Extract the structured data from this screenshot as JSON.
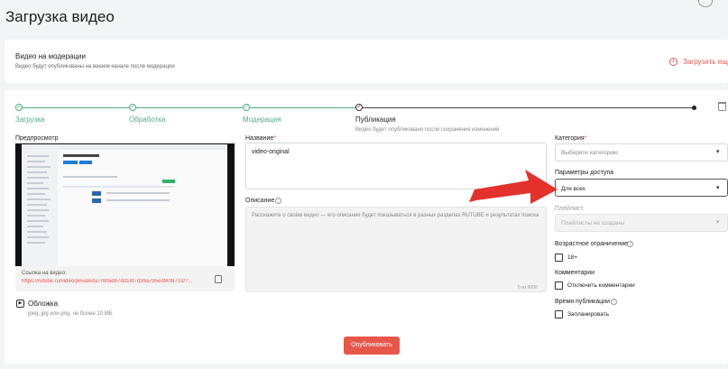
{
  "page": {
    "title": "Загрузка видео"
  },
  "moderation": {
    "title": "Видео на модерации",
    "subtitle": "Видео будут опубликованы на вашем канале после модерации",
    "upload_more": "Загрузить еще"
  },
  "stepper": {
    "steps": [
      {
        "label": "Загрузка",
        "state": "done"
      },
      {
        "label": "Обработка",
        "state": "done"
      },
      {
        "label": "Модерация",
        "state": "done"
      },
      {
        "label": "Публикация",
        "state": "current"
      }
    ],
    "current_note": "Видео будет опубликовано после сохранения изменений",
    "done_mark": "✓"
  },
  "preview": {
    "label": "Предпросмотр",
    "link_label": "Ссылка на видео:",
    "link_url": "https://rutube.ru/video/private/fa708fad87dd18f7d39a795ed90f8713/?..."
  },
  "cover": {
    "label": "Обложка",
    "hint": "jpeg, jpg или png, не более 10 МБ"
  },
  "form": {
    "name_label": "Название",
    "name_value": "video-original",
    "name_counter": "",
    "description_label": "Описание",
    "description_placeholder": "Расскажите о своём видео — его описание будет показываться в разных разделах RUTUBE и результатах поиска",
    "description_counter": "0 из 5000",
    "required_mark": "*",
    "help_mark": "?"
  },
  "settings": {
    "category_label": "Категория",
    "category_placeholder": "Выберите категорию",
    "access_label": "Параметры доступа",
    "access_value": "Для всех",
    "playlist_label": "Плейлист",
    "playlist_value": "Плейлисты не созданы",
    "age_label": "Возрастное ограничение",
    "age_option": "18+",
    "comments_label": "Комментарии",
    "comments_option": "Отключить комментарии",
    "time_label": "Время публикации",
    "time_option": "Запланировать"
  },
  "actions": {
    "publish": "Опубликовать"
  },
  "colors": {
    "accent": "#e8564a",
    "done": "#4caf7d",
    "arrow": "#e3322b"
  }
}
